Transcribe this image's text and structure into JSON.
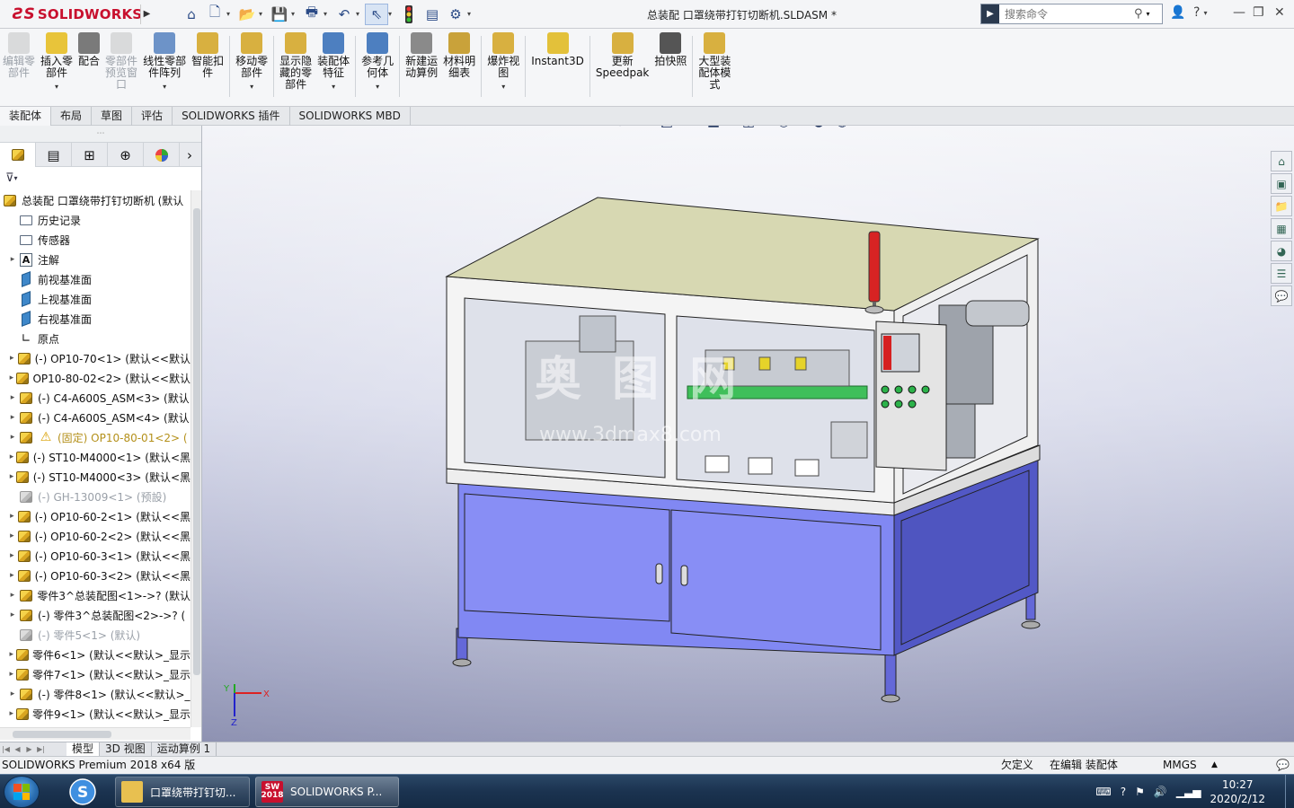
{
  "app": {
    "brand": "SOLIDWORKS",
    "doc_title": "总装配  口罩绕带打钉切断机.SLDASM *",
    "search_placeholder": "搜索命令"
  },
  "ribbon": [
    {
      "label": "编辑零\n部件",
      "icon": "edit-component-icon",
      "disabled": true
    },
    {
      "label": "插入零\n部件",
      "icon": "insert-component-icon",
      "disabled": false,
      "dropdown": true
    },
    {
      "label": "配合",
      "icon": "mate-icon",
      "disabled": false
    },
    {
      "label": "零部件\n预览窗\n口",
      "icon": "component-preview-icon",
      "disabled": true
    },
    {
      "label": "线性零部\n件阵列",
      "icon": "linear-pattern-icon",
      "disabled": false,
      "dropdown": true
    },
    {
      "label": "智能扣\n件",
      "icon": "smart-fastener-icon",
      "disabled": false
    },
    {
      "label": "移动零\n部件",
      "icon": "move-component-icon",
      "disabled": false,
      "dropdown": true
    },
    {
      "label": "显示隐\n藏的零\n部件",
      "icon": "show-hidden-icon",
      "disabled": false
    },
    {
      "label": "装配体\n特征",
      "icon": "assembly-feature-icon",
      "disabled": false,
      "dropdown": true
    },
    {
      "label": "参考几\n何体",
      "icon": "reference-geometry-icon",
      "disabled": false,
      "dropdown": true
    },
    {
      "label": "新建运\n动算例",
      "icon": "new-motion-study-icon",
      "disabled": false
    },
    {
      "label": "材料明\n细表",
      "icon": "bom-icon",
      "disabled": false
    },
    {
      "label": "爆炸视\n图",
      "icon": "exploded-view-icon",
      "disabled": false,
      "dropdown": true
    },
    {
      "label": "Instant3D",
      "icon": "instant3d-icon",
      "disabled": false
    },
    {
      "label": "更新\nSpeedpak",
      "icon": "speedpak-icon",
      "disabled": false
    },
    {
      "label": "拍快照",
      "icon": "snapshot-icon",
      "disabled": false
    },
    {
      "label": "大型装\n配体模\n式",
      "icon": "large-assembly-icon",
      "disabled": false
    }
  ],
  "cm_tabs": [
    "装配体",
    "布局",
    "草图",
    "评估",
    "SOLIDWORKS 插件",
    "SOLIDWORKS MBD"
  ],
  "tree": {
    "root": "总装配  口罩绕带打钉切断机 (默认",
    "items": [
      {
        "text": "历史记录",
        "icon": "history",
        "expand": false
      },
      {
        "text": "传感器",
        "icon": "sensor",
        "expand": false
      },
      {
        "text": "注解",
        "icon": "annotation",
        "expand": true
      },
      {
        "text": "前视基准面",
        "icon": "plane",
        "expand": false
      },
      {
        "text": "上视基准面",
        "icon": "plane",
        "expand": false
      },
      {
        "text": "右视基准面",
        "icon": "plane",
        "expand": false
      },
      {
        "text": "原点",
        "icon": "origin",
        "expand": false
      },
      {
        "text": "(-) OP10-70<1> (默认<<默认",
        "icon": "part",
        "expand": true
      },
      {
        "text": "OP10-80-02<2> (默认<<默认",
        "icon": "part",
        "expand": true
      },
      {
        "text": "(-) C4-A600S_ASM<3> (默认",
        "icon": "part",
        "expand": true
      },
      {
        "text": "(-) C4-A600S_ASM<4> (默认",
        "icon": "part",
        "expand": true
      },
      {
        "text": "(固定) OP10-80-01<2> (",
        "icon": "warn",
        "expand": true,
        "state": "warn"
      },
      {
        "text": "(-) ST10-M4000<1> (默认<黑",
        "icon": "part",
        "expand": true
      },
      {
        "text": "(-) ST10-M4000<3> (默认<黑",
        "icon": "part",
        "expand": true
      },
      {
        "text": "(-) GH-13009<1> (预設)",
        "icon": "part-grey",
        "expand": false,
        "state": "dim"
      },
      {
        "text": "(-) OP10-60-2<1> (默认<<黑",
        "icon": "part",
        "expand": true
      },
      {
        "text": "(-) OP10-60-2<2> (默认<<黑",
        "icon": "part",
        "expand": true
      },
      {
        "text": "(-) OP10-60-3<1> (默认<<黑",
        "icon": "part",
        "expand": true
      },
      {
        "text": "(-) OP10-60-3<2> (默认<<黑",
        "icon": "part",
        "expand": true
      },
      {
        "text": "零件3^总装配图<1>->? (默认",
        "icon": "part",
        "expand": true
      },
      {
        "text": "(-) 零件3^总装配图<2>->? (",
        "icon": "part",
        "expand": true
      },
      {
        "text": "(-) 零件5<1> (默认)",
        "icon": "part-grey",
        "expand": false,
        "state": "dim"
      },
      {
        "text": "零件6<1> (默认<<默认>_显示",
        "icon": "part",
        "expand": true
      },
      {
        "text": "零件7<1> (默认<<默认>_显示",
        "icon": "part",
        "expand": true
      },
      {
        "text": "(-) 零件8<1> (默认<<默认>_",
        "icon": "part",
        "expand": true
      },
      {
        "text": "零件9<1> (默认<<默认>_显示",
        "icon": "part",
        "expand": true
      }
    ]
  },
  "viewport": {
    "watermark": "奥 图 网",
    "watermark_url": "www.3dmax8.com",
    "triad": {
      "x": "X",
      "y": "Y",
      "z": "Z"
    }
  },
  "bottom_tabs": [
    "模型",
    "3D 视图",
    "运动算例 1"
  ],
  "status": {
    "product": "SOLIDWORKS Premium 2018 x64 版",
    "defined": "欠定义",
    "editing": "在编辑 装配体",
    "units": "MMGS",
    "units_arrow": "▲"
  },
  "taskbar": {
    "folder_window": "口罩绕带打钉切...",
    "sw_window": "SOLIDWORKS P...",
    "sw_icon_text": "2018",
    "time": "10:27",
    "date": "2020/2/12"
  },
  "colors": {
    "cabinet": "#7f85f0",
    "cabinet_dark": "#5a5fc8",
    "table_top": "#d8d9b4",
    "frame": "#f2f2f2"
  }
}
